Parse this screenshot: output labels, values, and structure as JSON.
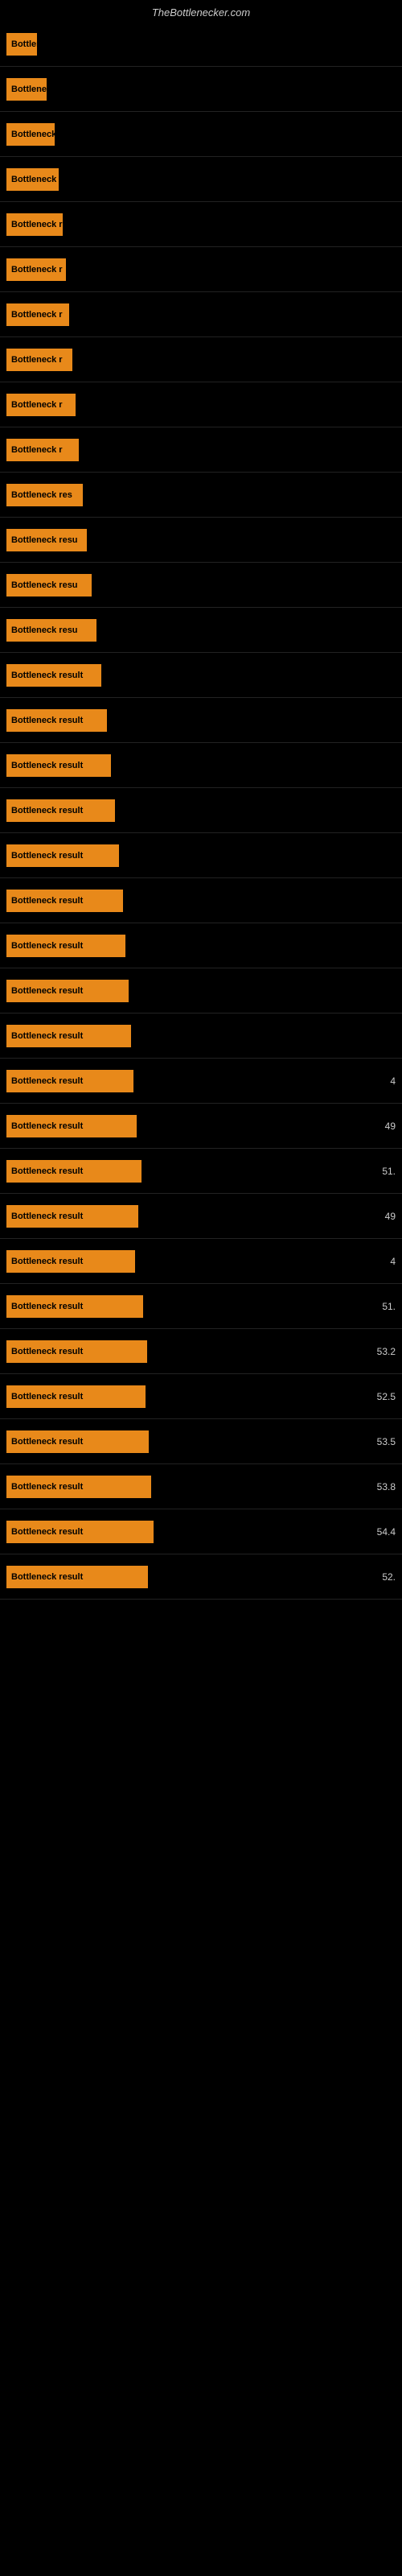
{
  "header": {
    "title": "TheBottlenecker.com"
  },
  "rows": [
    {
      "label": "Bottleneck",
      "width": 38,
      "value": ""
    },
    {
      "label": "Bottleneck r",
      "width": 50,
      "value": ""
    },
    {
      "label": "Bottleneck r",
      "width": 60,
      "value": ""
    },
    {
      "label": "Bottleneck r",
      "width": 65,
      "value": ""
    },
    {
      "label": "Bottleneck r",
      "width": 70,
      "value": ""
    },
    {
      "label": "Bottleneck r",
      "width": 74,
      "value": ""
    },
    {
      "label": "Bottleneck r",
      "width": 78,
      "value": ""
    },
    {
      "label": "Bottleneck r",
      "width": 82,
      "value": ""
    },
    {
      "label": "Bottleneck r",
      "width": 86,
      "value": ""
    },
    {
      "label": "Bottleneck r",
      "width": 90,
      "value": ""
    },
    {
      "label": "Bottleneck res",
      "width": 95,
      "value": ""
    },
    {
      "label": "Bottleneck resu",
      "width": 100,
      "value": ""
    },
    {
      "label": "Bottleneck resu",
      "width": 106,
      "value": ""
    },
    {
      "label": "Bottleneck resu",
      "width": 112,
      "value": ""
    },
    {
      "label": "Bottleneck result",
      "width": 118,
      "value": ""
    },
    {
      "label": "Bottleneck result",
      "width": 125,
      "value": ""
    },
    {
      "label": "Bottleneck result",
      "width": 130,
      "value": ""
    },
    {
      "label": "Bottleneck result",
      "width": 135,
      "value": ""
    },
    {
      "label": "Bottleneck result",
      "width": 140,
      "value": ""
    },
    {
      "label": "Bottleneck result",
      "width": 145,
      "value": ""
    },
    {
      "label": "Bottleneck result",
      "width": 148,
      "value": ""
    },
    {
      "label": "Bottleneck result",
      "width": 152,
      "value": ""
    },
    {
      "label": "Bottleneck result",
      "width": 155,
      "value": ""
    },
    {
      "label": "Bottleneck result",
      "width": 158,
      "value": "4"
    },
    {
      "label": "Bottleneck result",
      "width": 162,
      "value": "49"
    },
    {
      "label": "Bottleneck result",
      "width": 168,
      "value": "51."
    },
    {
      "label": "Bottleneck result",
      "width": 164,
      "value": "49"
    },
    {
      "label": "Bottleneck result",
      "width": 160,
      "value": "4"
    },
    {
      "label": "Bottleneck result",
      "width": 170,
      "value": "51."
    },
    {
      "label": "Bottleneck result",
      "width": 175,
      "value": "53.2"
    },
    {
      "label": "Bottleneck result",
      "width": 173,
      "value": "52.5"
    },
    {
      "label": "Bottleneck result",
      "width": 177,
      "value": "53.5"
    },
    {
      "label": "Bottleneck result",
      "width": 180,
      "value": "53.8"
    },
    {
      "label": "Bottleneck result",
      "width": 183,
      "value": "54.4"
    },
    {
      "label": "Bottleneck result",
      "width": 176,
      "value": "52."
    }
  ]
}
